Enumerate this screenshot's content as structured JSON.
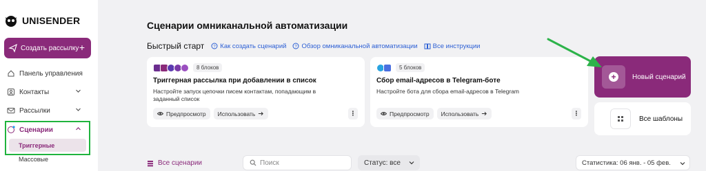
{
  "brand": {
    "name": "UNISENDER",
    "accent": "#8a2a7a",
    "highlight": "#1fb33d"
  },
  "sidebar": {
    "create_button": "Создать рассылку",
    "items": [
      {
        "label": "Панель управления",
        "icon": "dashboard-icon"
      },
      {
        "label": "Контакты",
        "icon": "contacts-icon"
      },
      {
        "label": "Рассылки",
        "icon": "mail-icon"
      },
      {
        "label": "Сценарии",
        "icon": "scenarios-icon"
      }
    ],
    "subitems": [
      {
        "label": "Триггерные"
      },
      {
        "label": "Массовые"
      }
    ]
  },
  "main": {
    "title": "Сценарии омниканальной автоматизации",
    "quick_start": {
      "label": "Быстрый старт",
      "links": [
        {
          "label": "Как создать сценарий",
          "icon": "help-circle-icon"
        },
        {
          "label": "Обзор омниканальной автоматизации",
          "icon": "help-circle-icon"
        },
        {
          "label": "Все инструкции",
          "icon": "book-icon"
        }
      ]
    },
    "cards": [
      {
        "badge": "8 блоков",
        "title": "Триггерная рассылка при добавлении в список",
        "description": "Настройте запуск цепочки писем контактам, попадающим в заданный список",
        "preview": "Предпросмотр",
        "use": "Использовать",
        "more": "⋮"
      },
      {
        "badge": "5 блоков",
        "title": "Сбор email-адресов в Telegram-боте",
        "description": "Настройте бота для сбора email-адресов в Telegram",
        "preview": "Предпросмотр",
        "use": "Использовать",
        "more": "⋮"
      }
    ],
    "new_scenario": "Новый сценарий",
    "all_templates": "Все шаблоны"
  },
  "toolbar": {
    "all_scenarios": "Все сценарии",
    "search_placeholder": "Поиск",
    "status": "Статус: все",
    "stats": "Статистика: 06 янв. - 05 фев."
  }
}
